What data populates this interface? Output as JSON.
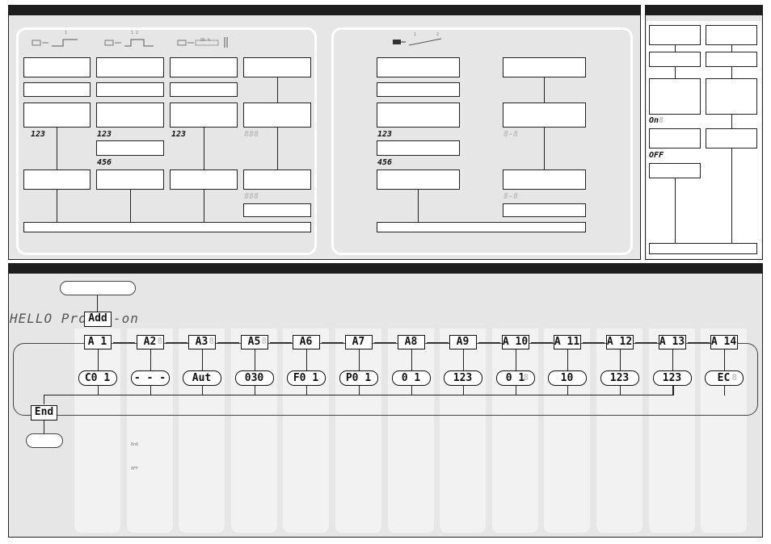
{
  "panel_a": {
    "group_left": {
      "icon_labels": [
        "1",
        "1 2",
        "85 %"
      ],
      "readouts": [
        "123",
        "123",
        "123"
      ],
      "readout_456": "456",
      "blank_readout_1": "888",
      "blank_readout_2": "888"
    },
    "group_right": {
      "icon_labels": [
        "1",
        "2"
      ],
      "readout_123": "123",
      "readout_456": "456",
      "blank_readout_1": "8-8",
      "blank_readout_2": "8-8"
    }
  },
  "panel_b": {
    "on_label": "On",
    "on_dim": "8",
    "off_label": "OFF"
  },
  "panel_c": {
    "hello_text": "HELLO Pro",
    "addon_box": "Add",
    "addon_suffix": "-on",
    "end_label": "End",
    "menu": [
      {
        "code": "A 1",
        "dim": "",
        "value": "C0 1",
        "value_dim": ""
      },
      {
        "code": "A2",
        "dim": "8",
        "value": "- - -",
        "value_dim": ""
      },
      {
        "code": "A3",
        "dim": "8",
        "value": "Aut",
        "value_dim": ""
      },
      {
        "code": "A5",
        "dim": "8",
        "value": "030",
        "value_dim": ""
      },
      {
        "code": "A6",
        "dim": "",
        "value": "F0 1",
        "value_dim": ""
      },
      {
        "code": "A7",
        "dim": "",
        "value": "P0 1",
        "value_dim": ""
      },
      {
        "code": "A8",
        "dim": "",
        "value": "0 1",
        "value_dim": ""
      },
      {
        "code": "A9",
        "dim": "",
        "value": "123",
        "value_dim": ""
      },
      {
        "code": "A 10",
        "dim": "",
        "value": "0 1",
        "value_dim": "8"
      },
      {
        "code": "A 11",
        "dim": "",
        "value": "10",
        "value_dim": ""
      },
      {
        "code": "A 12",
        "dim": "",
        "value": "123",
        "value_dim": ""
      },
      {
        "code": "A 13",
        "dim": "",
        "value": "123",
        "value_dim": ""
      },
      {
        "code": "A 14",
        "dim": "",
        "value": "EC",
        "value_dim": "8"
      }
    ],
    "small_on": "8n8",
    "small_off": "0FF"
  }
}
